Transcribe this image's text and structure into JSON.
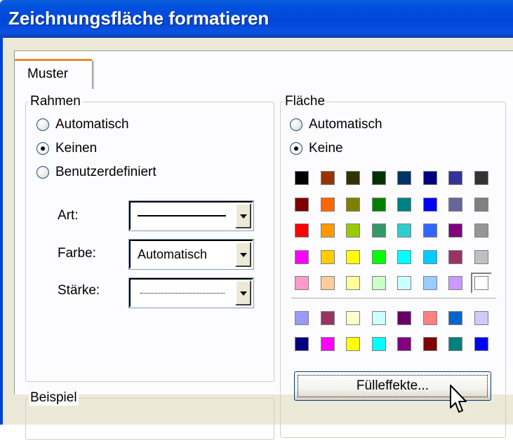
{
  "window": {
    "title": "Zeichnungsfläche formatieren"
  },
  "tabs": [
    {
      "label": "Muster",
      "active": true
    }
  ],
  "rahmen": {
    "label": "Rahmen",
    "options": [
      {
        "label": "Automatisch",
        "checked": false
      },
      {
        "label": "Keinen",
        "checked": true
      },
      {
        "label": "Benutzerdefiniert",
        "checked": false
      }
    ],
    "art": {
      "label": "Art:",
      "value": "solid line"
    },
    "farbe": {
      "label": "Farbe:",
      "value": "Automatisch"
    },
    "staerke": {
      "label": "Stärke:",
      "value": "hairline"
    }
  },
  "beispiel": {
    "label": "Beispiel"
  },
  "flaeche": {
    "label": "Fläche",
    "options": [
      {
        "label": "Automatisch",
        "checked": false
      },
      {
        "label": "Keine",
        "checked": true
      }
    ],
    "palette": [
      [
        "#000000",
        "#993300",
        "#333300",
        "#003300",
        "#003366",
        "#000080",
        "#333399",
        "#333333"
      ],
      [
        "#800000",
        "#ff6600",
        "#808000",
        "#008000",
        "#008080",
        "#0000ff",
        "#666699",
        "#808080"
      ],
      [
        "#ff0000",
        "#ff9900",
        "#99cc00",
        "#339966",
        "#33cccc",
        "#3366ff",
        "#800080",
        "#969696"
      ],
      [
        "#ff00ff",
        "#ffcc00",
        "#ffff00",
        "#00ff00",
        "#00ffff",
        "#00ccff",
        "#993366",
        "#c0c0c0"
      ],
      [
        "#ff99cc",
        "#ffcc99",
        "#ffff99",
        "#ccffcc",
        "#ccffff",
        "#99ccff",
        "#cc99ff",
        "#ffffff"
      ]
    ],
    "chart_palette": [
      [
        "#9999ff",
        "#993366",
        "#ffffcc",
        "#ccffff",
        "#660066",
        "#ff8080",
        "#0066cc",
        "#ccccff"
      ],
      [
        "#000080",
        "#ff00ff",
        "#ffff00",
        "#00ffff",
        "#800080",
        "#800000",
        "#008080",
        "#0000ff"
      ]
    ],
    "selected_color": "#ffffff",
    "fill_effects_button": "Fülleffekte..."
  }
}
